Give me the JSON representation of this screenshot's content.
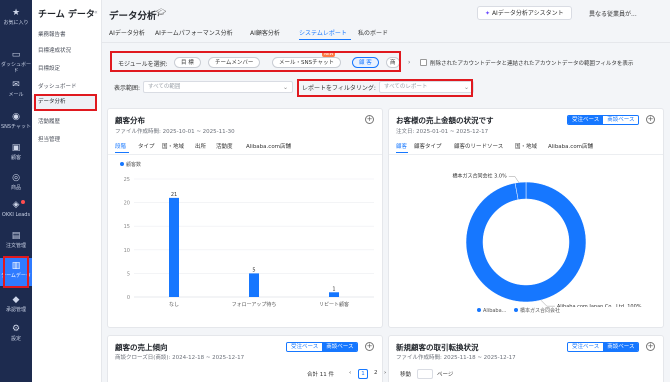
{
  "rail": {
    "items": [
      {
        "icon": "star-icon",
        "label": "お気に入り"
      },
      {
        "icon": "message-icon",
        "label": "ダッシュボード"
      },
      {
        "icon": "mail-icon",
        "label": "メール"
      },
      {
        "icon": "chat-icon",
        "label": "SNSチャット"
      },
      {
        "icon": "customer-icon",
        "label": "顧客"
      },
      {
        "icon": "product-icon",
        "label": "商品"
      },
      {
        "icon": "leads-icon",
        "label": "OKKI Leads"
      },
      {
        "icon": "order-icon",
        "label": "注文管理"
      },
      {
        "icon": "team-data-icon",
        "label": "チームデータ"
      },
      {
        "icon": "approval-icon",
        "label": "承認管理"
      },
      {
        "icon": "settings-icon",
        "label": "設定"
      }
    ]
  },
  "sidebar": {
    "title": "チーム データ",
    "items": [
      "業務報告書",
      "目標達成状況",
      "目標設定",
      "ダッシュボード",
      "データ分析",
      "活動履歴",
      "担当管理"
    ]
  },
  "header": {
    "title": "データ分析",
    "ai_assist_label": "AIデータ分析アシスタント",
    "employee_label": "異なる従業員が..."
  },
  "tabs": [
    "AIデータ分析",
    "AIチームパフォーマンス分析",
    "AI顧客分析",
    "システムレポート",
    "私のボード"
  ],
  "filters": {
    "module_label": "モジュールを選択:",
    "modules": [
      "目 標",
      "チームメンバー",
      "メール・SNSチャット",
      "顧 客",
      "商"
    ],
    "new_badge": "NEW",
    "checkbox_label": "削除されたアカウントデータと連結されたアカウントデータの範囲フィルタを表示",
    "scope_label": "表示範囲:",
    "scope_placeholder": "すべての範囲",
    "report_filter_label": "レポートをフィルタリング:",
    "report_filter_placeholder": "すべてのレポート"
  },
  "cards": {
    "customer_dist": {
      "title": "顧客分布",
      "subtitle": "ファイル作成時間: 2025-10-01 ~ 2025-11-30",
      "tabs": [
        "段階",
        "タイプ",
        "国・地域",
        "出所",
        "活動度",
        "Alibaba.com店舗"
      ],
      "legend": "顧客数"
    },
    "sales_status": {
      "title": "お客様の売上金額の状況です",
      "subtitle": "注文日: 2025-01-01 ~ 2025-12-17",
      "toggle": [
        "受注ベース",
        "商談ベース"
      ],
      "tabs": [
        "顧客",
        "顧客タイプ",
        "顧客のリードソース",
        "国・地域",
        "Alibaba.com店舗"
      ],
      "legend": [
        "Alibaba...",
        "橋本ガス合同会社"
      ]
    },
    "sales_trend": {
      "title": "顧客の売上傾向",
      "subtitle": "商談クローズ日(商談): 2024-12-18 ~ 2025-12-17",
      "toggle": [
        "受注ベース",
        "商談ベース"
      ]
    },
    "new_customer": {
      "title": "新規顧客の取引転換状況",
      "subtitle": "ファイル作成時間: 2025-11-18 ~ 2025-12-17",
      "toggle": [
        "受注ベース",
        "商談ベース"
      ]
    }
  },
  "pager": {
    "total": "合計 11 件",
    "pages": [
      "1",
      "2"
    ],
    "jump_label": "移動",
    "page_suffix": "ページ"
  },
  "chart_data": [
    {
      "type": "bar",
      "categories": [
        "なし",
        "フォローアップ待ち",
        "リピート顧客"
      ],
      "series": [
        {
          "name": "顧客数",
          "values": [
            21,
            5,
            1
          ]
        }
      ],
      "ylim": [
        0,
        25
      ],
      "yticks": [
        0,
        5,
        10,
        15,
        20,
        25
      ],
      "grid": true,
      "legend": "top-left"
    },
    {
      "type": "pie",
      "donut": true,
      "labels": [
        "Alibaba.com Japan Co., Ltd.",
        "橋本ガス合同会社"
      ],
      "values": [
        100,
        3.0
      ],
      "value_labels": [
        "Alibaba.com Japan Co., Ltd. 100%",
        "橋本ガス合同会社 3.0%"
      ],
      "colors": [
        "#1677ff",
        "#1677ff"
      ],
      "legend": "bottom"
    }
  ],
  "colors": {
    "accent": "#1677ff",
    "rail": "#1d2b4f",
    "highlight": "#e0191f"
  }
}
